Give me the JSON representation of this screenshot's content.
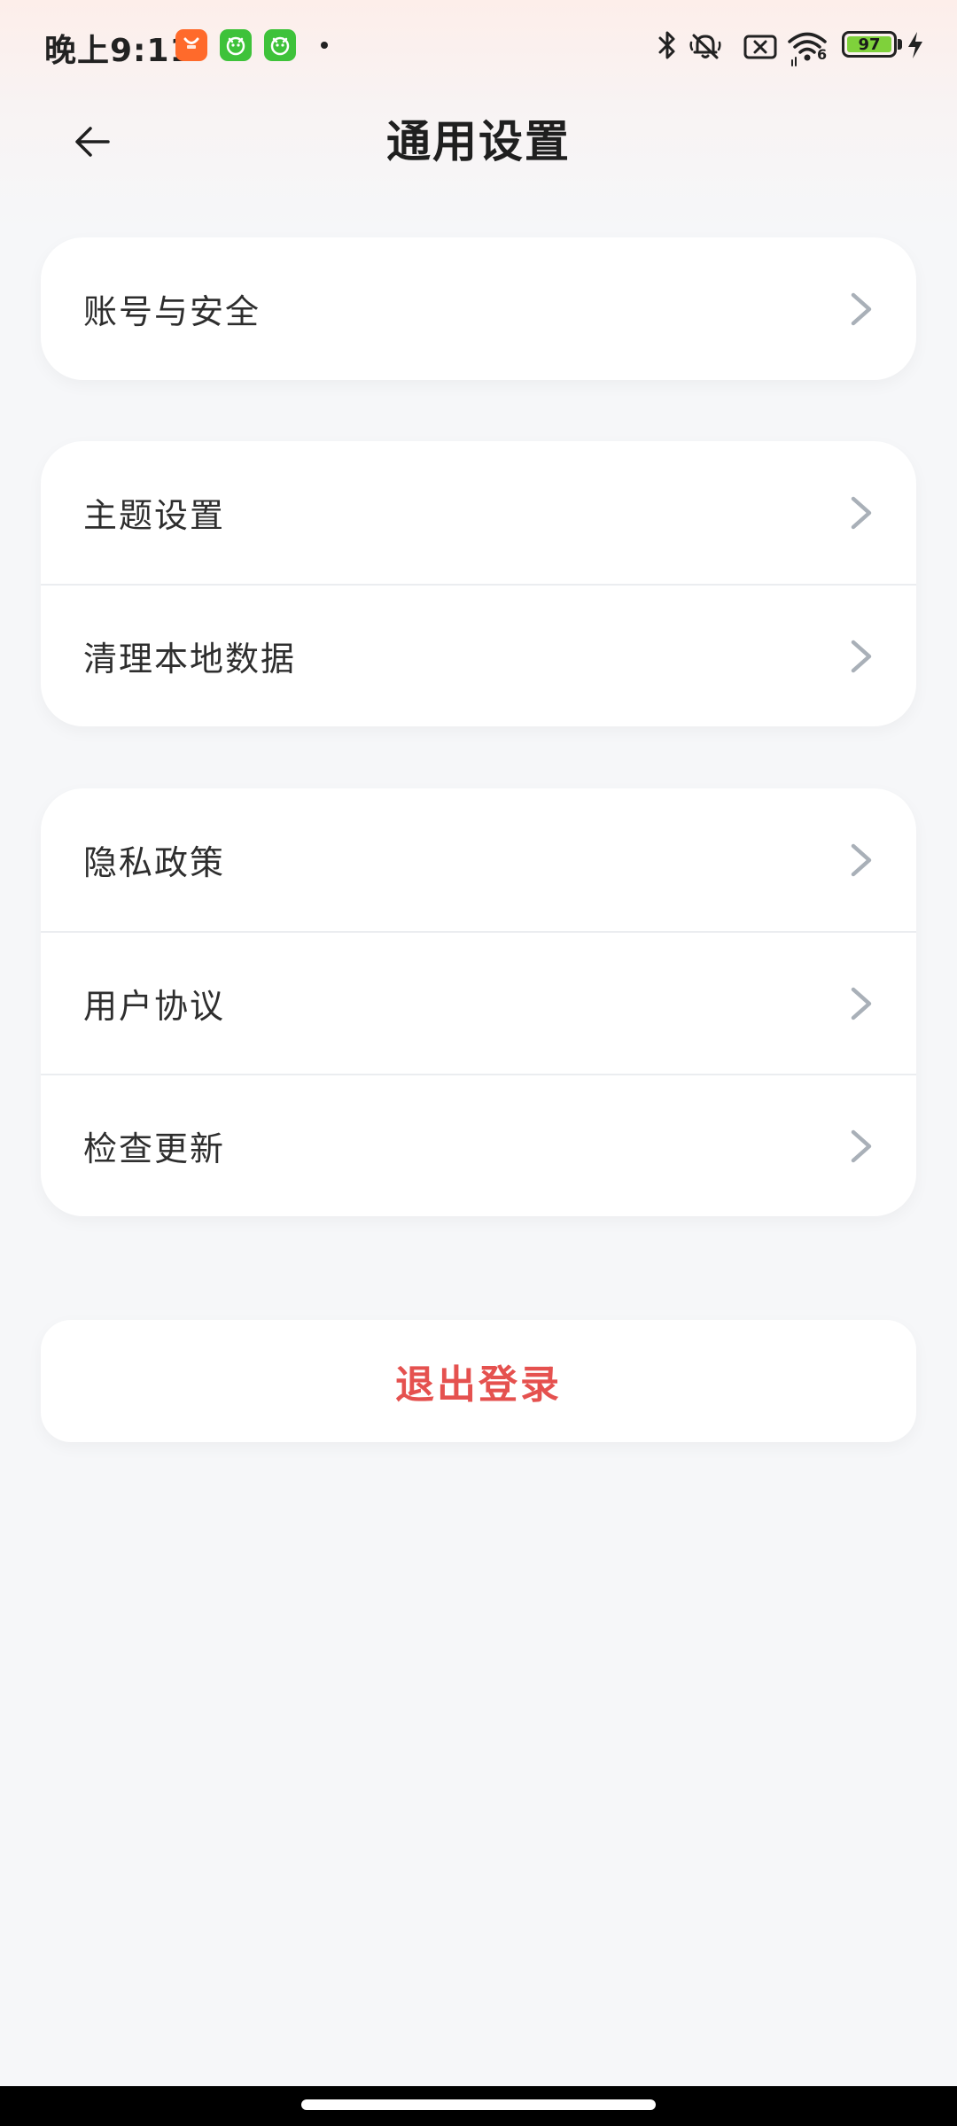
{
  "status_bar": {
    "time": "晚上9:11",
    "battery_level": "97",
    "icons": [
      "taobao-icon",
      "app-icon",
      "app-icon",
      "bluetooth-icon",
      "mute-icon",
      "no-sim-icon",
      "wifi-icon",
      "battery-icon",
      "charging-icon"
    ],
    "wifi_badge": "6"
  },
  "header": {
    "title": "通用设置",
    "back_icon": "arrow-left-icon"
  },
  "groups": [
    {
      "items": [
        {
          "label": "账号与安全"
        }
      ]
    },
    {
      "items": [
        {
          "label": "主题设置"
        },
        {
          "label": "清理本地数据"
        }
      ]
    },
    {
      "items": [
        {
          "label": "隐私政策"
        },
        {
          "label": "用户协议"
        },
        {
          "label": "检查更新"
        }
      ]
    }
  ],
  "logout": {
    "label": "退出登录"
  },
  "colors": {
    "accent_red": "#e5514f",
    "battery_green": "#7fd13b",
    "background": "#f6f7f9",
    "card": "#ffffff",
    "chevron": "#a9b0b8"
  }
}
